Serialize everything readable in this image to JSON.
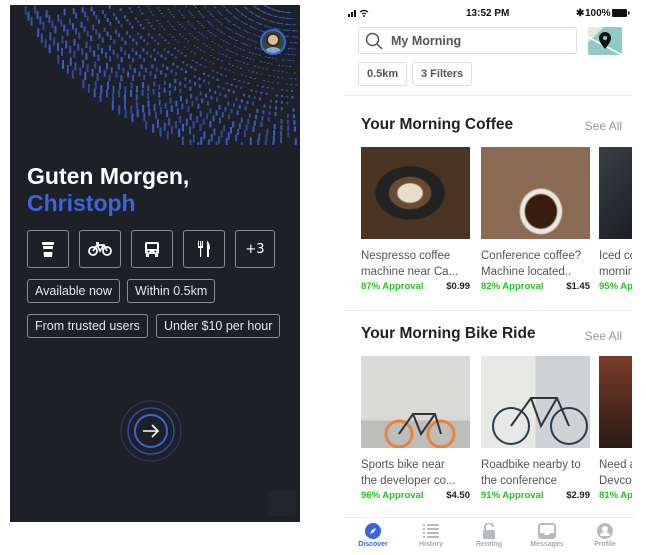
{
  "colors": {
    "accent": "#3d63dd",
    "background_dark": "#1e2028",
    "approval_green": "#23c323"
  },
  "welcome": {
    "greeting": "Guten Morgen,",
    "name": "Christoph",
    "categories": [
      {
        "icon": "coffee-cup-icon"
      },
      {
        "icon": "bicycle-icon"
      },
      {
        "icon": "bus-icon"
      },
      {
        "icon": "fork-knife-icon"
      },
      {
        "label": "+3"
      }
    ],
    "tags": [
      "Available now",
      "Within 0.5km",
      "From trusted users",
      "Under $10 per hour"
    ],
    "next_icon": "arrow-right-icon"
  },
  "status_bar": {
    "time": "13:52 PM",
    "battery": "100%"
  },
  "search": {
    "value": "My Morning"
  },
  "chips": [
    "0.5km",
    "3 Filters"
  ],
  "sections": [
    {
      "title": "Your Morning Coffee",
      "see_all": "See All",
      "cards": [
        {
          "title": "Nespresso coffee",
          "title2": "machine near Ca...",
          "approval": "87% Approval",
          "price": "$0.99"
        },
        {
          "title": "Conference coffee?",
          "title2": "Machine located..",
          "approval": "82% Approval",
          "price": "$1.45"
        },
        {
          "title": "Iced co",
          "title2": "mornin",
          "approval": "95% Ap",
          "price": ""
        }
      ]
    },
    {
      "title": "Your Morning Bike Ride",
      "see_all": "See All",
      "cards": [
        {
          "title": "Sports bike near",
          "title2": "the developer co...",
          "approval": "96% Approval",
          "price": "$4.50"
        },
        {
          "title": "Roadbike nearby to",
          "title2": "the conference",
          "approval": "91% Approval",
          "price": "$2.99"
        },
        {
          "title": "Need a",
          "title2": "Devco",
          "approval": "81% Ap",
          "price": ""
        }
      ]
    }
  ],
  "tabs": [
    {
      "label": "Discover",
      "icon": "compass-icon",
      "active": true
    },
    {
      "label": "History",
      "icon": "list-icon"
    },
    {
      "label": "Renting",
      "icon": "unlock-icon"
    },
    {
      "label": "Messages",
      "icon": "inbox-icon"
    },
    {
      "label": "Profile",
      "icon": "profile-icon"
    }
  ]
}
